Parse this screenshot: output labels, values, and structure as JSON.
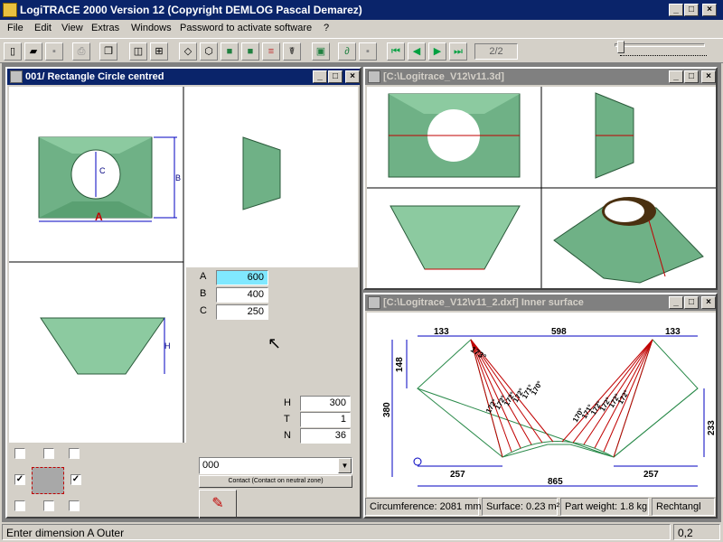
{
  "app": {
    "title": "LogiTRACE 2000  Version 12  (Copyright DEMLOG Pascal Demarez)"
  },
  "menu": [
    "File",
    "Edit",
    "View",
    "Extras",
    "Windows",
    "Password to activate software",
    "?"
  ],
  "toolbar": {
    "page": "2/2"
  },
  "win1": {
    "title": "001/ Rectangle Circle centred",
    "dims": {
      "A": "A",
      "B": "B",
      "C": "C",
      "H": "H"
    },
    "fields": [
      {
        "label": "A",
        "value": "600"
      },
      {
        "label": "B",
        "value": "400"
      },
      {
        "label": "C",
        "value": "250"
      }
    ],
    "fields2": [
      {
        "label": "H",
        "value": "300"
      },
      {
        "label": "T",
        "value": "1"
      },
      {
        "label": "N",
        "value": "36"
      }
    ],
    "combo": "000",
    "contact_button": "Contact (Contact on neutral zone)"
  },
  "win2": {
    "title": "[C:\\Logitrace_V12\\v11.3d]"
  },
  "win3": {
    "title": "[C:\\Logitrace_V12\\v11_2.dxf]  Inner surface",
    "dims": {
      "top_left": "133",
      "top_mid": "598",
      "top_right": "133",
      "left_small": "148",
      "left_big": "380",
      "right": "233",
      "bot_left": "257",
      "bot_right": "257",
      "bot_total": "865"
    },
    "angle_left": "173°",
    "angles_left_fan": [
      "172°",
      "172°",
      "172°",
      "172°",
      "171°",
      "170°"
    ],
    "angles_right_fan": [
      "170°",
      "171°",
      "172°",
      "172°",
      "172°",
      "172°"
    ],
    "status": {
      "circumference": "Circumference: 2081 mm",
      "surface": "Surface: 0.23 m²",
      "weight": "Part weight: 1.8 kg",
      "shape": "Rechtangl"
    }
  },
  "status": {
    "message": "Enter dimension A Outer",
    "right": "0,2"
  },
  "colors": {
    "face": "#7ab890",
    "titlebar": "#0a246a",
    "dim": "#0000c0",
    "red": "#c00000"
  }
}
